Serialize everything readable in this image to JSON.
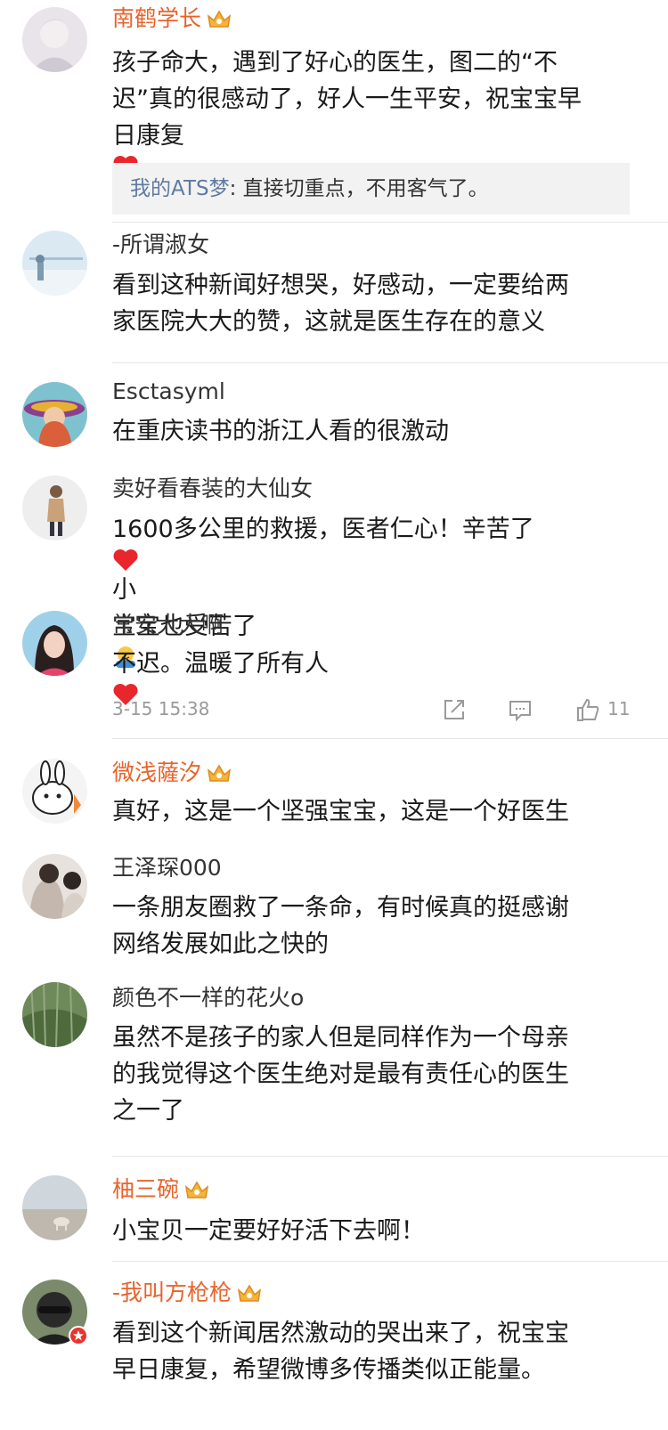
{
  "comments": [
    {
      "username": "南鹤学长",
      "vip": true,
      "lines": [
        "孩子命大，遇到了好心的医生，图二的“不",
        "迟”真的很感动了，好人一生平安，祝宝宝早",
        "日康复"
      ],
      "reply": {
        "name": "我的ATS梦",
        "text": ": 直接切重点，不用客气了。"
      }
    },
    {
      "username": "-所谓淑女",
      "vip": false,
      "lines": [
        "看到这种新闻好想哭，好感动，一定要给两",
        "家医院大大的赞，这就是医生存在的意义"
      ]
    },
    {
      "username": "Esctasyml",
      "vip": false,
      "lines": [
        "在重庆读书的浙江人看的很激动"
      ]
    },
    {
      "username": "卖好看春装的大仙女",
      "vip": false,
      "lines": [
        "1600多公里的救援，医者仁心！辛苦了",
        "小",
        "宝宝也受苦了"
      ]
    },
    {
      "username": "常安大大啊",
      "vip": false,
      "lines": [
        "不迟。温暖了所有人"
      ],
      "meta": {
        "time": "3-15 15:38",
        "likes": "11"
      }
    },
    {
      "username": "微浅薩汐",
      "vip": true,
      "lines": [
        "真好，这是一个坚强宝宝，这是一个好医生"
      ]
    },
    {
      "username": "王泽琛000",
      "vip": false,
      "lines": [
        "一条朋友圈救了一条命，有时候真的挺感谢",
        "网络发展如此之快的"
      ]
    },
    {
      "username": "颜色不一样的花火o",
      "vip": false,
      "lines": [
        "虽然不是孩子的家人但是同样作为一个母亲",
        "的我觉得这个医生绝对是最有责任心的医生",
        "之一了"
      ]
    },
    {
      "username": "柚三碗",
      "vip": true,
      "lines": [
        "小宝贝一定要好好活下去啊！"
      ]
    },
    {
      "username": "-我叫方枪枪",
      "vip": true,
      "lines": [
        "看到这个新闻居然激动的哭出来了，祝宝宝",
        "早日康复，希望微博多传播类似正能量。"
      ]
    }
  ],
  "icons": {
    "crown": "vip-crown-icon",
    "heart": "red-heart-emoji",
    "hug": "hug-emoji",
    "share": "share-icon",
    "comment": "comment-icon",
    "like": "thumbs-up-icon"
  },
  "colors": {
    "vip_name": "#e8632c",
    "reply_name": "#5f7aa1",
    "meta": "#9a9a9a",
    "heart": "#e8262c"
  }
}
